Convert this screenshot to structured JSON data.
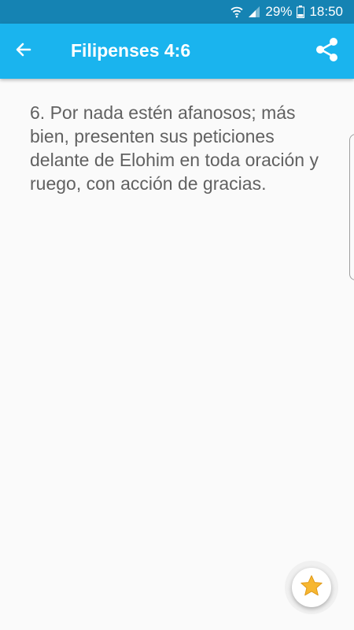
{
  "status_bar": {
    "battery_percent": "29%",
    "time": "18:50",
    "icons": [
      "wifi-icon",
      "signal-icon",
      "battery-icon"
    ]
  },
  "app_bar": {
    "title": "Filipenses 4:6",
    "back_icon": "arrow-left-icon",
    "share_icon": "share-icon"
  },
  "verse": {
    "text": "6. Por nada estén afanosos; más bien, presenten sus peticiones delante de Elohim en toda oración y ruego, con acción de gracias."
  },
  "fab": {
    "icon": "star-icon"
  },
  "colors": {
    "status_bar": "#1583b3",
    "app_bar": "#1ab4ee",
    "text": "#616161",
    "star": "#f7b731"
  }
}
